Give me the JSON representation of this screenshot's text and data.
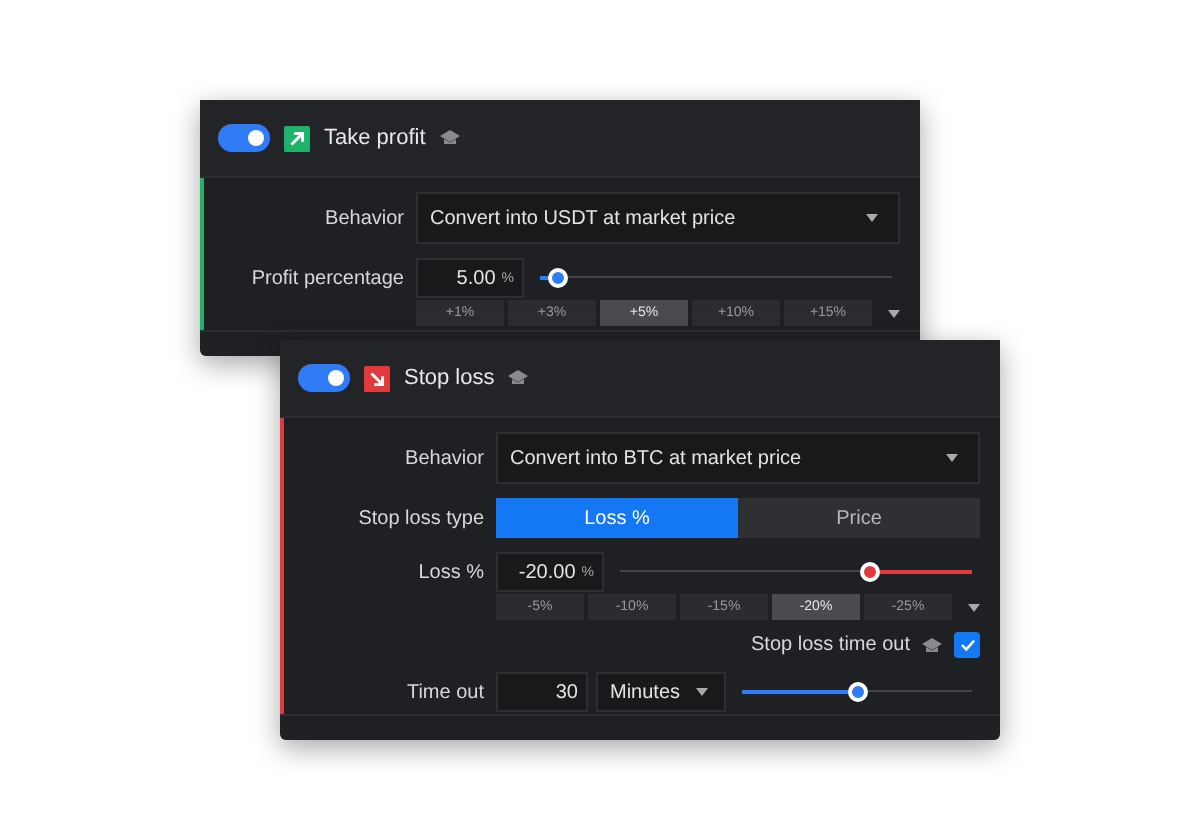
{
  "panels": [
    {
      "title": "Take profit",
      "enabled": true,
      "kind": "profit",
      "color": "#1fb26b",
      "behavior": {
        "label": "Behavior",
        "value": "Convert into USDT at market price"
      },
      "percentage": {
        "label": "Profit percentage",
        "value": "5.00",
        "unit": "%",
        "level": 0.05,
        "presets": [
          {
            "label": "+1%",
            "selected": false
          },
          {
            "label": "+3%",
            "selected": false
          },
          {
            "label": "+5%",
            "selected": true
          },
          {
            "label": "+10%",
            "selected": false
          },
          {
            "label": "+15%",
            "selected": false
          }
        ]
      }
    },
    {
      "title": "Stop loss",
      "enabled": true,
      "kind": "loss",
      "color": "#e0393e",
      "behavior": {
        "label": "Behavior",
        "value": "Convert into BTC at market price"
      },
      "type": {
        "label": "Stop loss type",
        "options": [
          {
            "label": "Loss %",
            "selected": true
          },
          {
            "label": "Price",
            "selected": false
          }
        ]
      },
      "percentage": {
        "label": "Loss %",
        "value": "-20.00",
        "unit": "%",
        "level": 0.71,
        "presets": [
          {
            "label": "-5%",
            "selected": false
          },
          {
            "label": "-10%",
            "selected": false
          },
          {
            "label": "-15%",
            "selected": false
          },
          {
            "label": "-20%",
            "selected": true
          },
          {
            "label": "-25%",
            "selected": false
          }
        ]
      },
      "timeout_toggle": {
        "label": "Stop loss time out",
        "checked": true
      },
      "timeout": {
        "label": "Time out",
        "value": "30",
        "unit": "Minutes",
        "level": 0.5
      }
    }
  ]
}
